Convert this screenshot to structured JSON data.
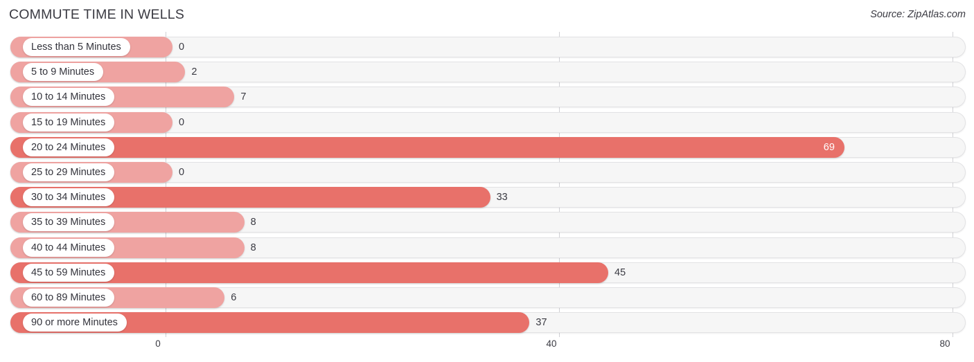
{
  "header": {
    "title": "COMMUTE TIME IN WELLS",
    "source": "Source: ZipAtlas.com"
  },
  "axis": {
    "ticks": [
      "0",
      "40",
      "80"
    ],
    "tick_values": [
      0,
      40,
      80
    ]
  },
  "colors": {
    "bar_light": "#efa3a1",
    "bar_dark": "#e8716a",
    "track": "#f6f6f6",
    "track_border": "#e2e2e4",
    "gridline": "#d0d0d4",
    "text": "#3a3a42",
    "value_inside": "#ffffff"
  },
  "chart_data": {
    "type": "bar",
    "orientation": "horizontal",
    "title": "COMMUTE TIME IN WELLS",
    "xlabel": "",
    "ylabel": "",
    "xlim": [
      0,
      80
    ],
    "xticks": [
      0,
      40,
      80
    ],
    "grid": true,
    "legend": "none",
    "categories": [
      "Less than 5 Minutes",
      "5 to 9 Minutes",
      "10 to 14 Minutes",
      "15 to 19 Minutes",
      "20 to 24 Minutes",
      "25 to 29 Minutes",
      "30 to 34 Minutes",
      "35 to 39 Minutes",
      "40 to 44 Minutes",
      "45 to 59 Minutes",
      "60 to 89 Minutes",
      "90 or more Minutes"
    ],
    "values": [
      0,
      2,
      7,
      0,
      69,
      0,
      33,
      8,
      8,
      45,
      6,
      37
    ],
    "value_labels": [
      "0",
      "2",
      "7",
      "0",
      "69",
      "0",
      "33",
      "8",
      "8",
      "45",
      "6",
      "37"
    ]
  },
  "rows": [
    {
      "label": "Less than 5 Minutes",
      "value": 0,
      "value_label": "0",
      "tone": "light",
      "label_inside": true
    },
    {
      "label": "5 to 9 Minutes",
      "value": 2,
      "value_label": "2",
      "tone": "light",
      "label_inside": true
    },
    {
      "label": "10 to 14 Minutes",
      "value": 7,
      "value_label": "7",
      "tone": "light",
      "label_inside": true
    },
    {
      "label": "15 to 19 Minutes",
      "value": 0,
      "value_label": "0",
      "tone": "light",
      "label_inside": true
    },
    {
      "label": "20 to 24 Minutes",
      "value": 69,
      "value_label": "69",
      "tone": "dark",
      "label_inside": false
    },
    {
      "label": "25 to 29 Minutes",
      "value": 0,
      "value_label": "0",
      "tone": "light",
      "label_inside": true
    },
    {
      "label": "30 to 34 Minutes",
      "value": 33,
      "value_label": "33",
      "tone": "dark",
      "label_inside": true
    },
    {
      "label": "35 to 39 Minutes",
      "value": 8,
      "value_label": "8",
      "tone": "light",
      "label_inside": true
    },
    {
      "label": "40 to 44 Minutes",
      "value": 8,
      "value_label": "8",
      "tone": "light",
      "label_inside": true
    },
    {
      "label": "45 to 59 Minutes",
      "value": 45,
      "value_label": "45",
      "tone": "dark",
      "label_inside": true
    },
    {
      "label": "60 to 89 Minutes",
      "value": 6,
      "value_label": "6",
      "tone": "light",
      "label_inside": true
    },
    {
      "label": "90 or more Minutes",
      "value": 37,
      "value_label": "37",
      "tone": "dark",
      "label_inside": true
    }
  ]
}
